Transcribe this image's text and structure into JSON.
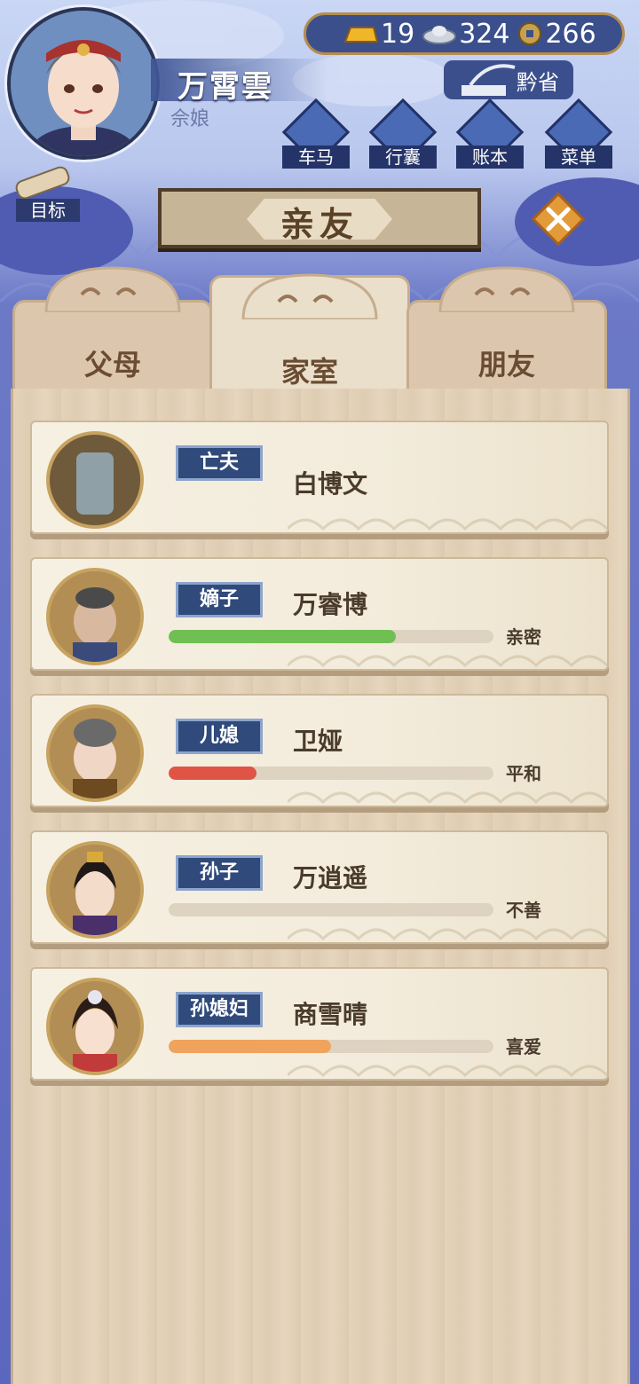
{
  "player": {
    "name": "万霄雲",
    "title": "佘娘"
  },
  "currency": {
    "gold": "19",
    "silver": "324",
    "coin": "266"
  },
  "region": "黔省",
  "menu": [
    {
      "label": "车马",
      "icon": "carriage-icon"
    },
    {
      "label": "行囊",
      "icon": "bag-icon"
    },
    {
      "label": "账本",
      "icon": "ledger-icon"
    },
    {
      "label": "菜单",
      "icon": "more-icon"
    }
  ],
  "goal_label": "目标",
  "page_title": "亲友",
  "tabs": [
    {
      "label": "父母",
      "active": false
    },
    {
      "label": "家室",
      "active": true
    },
    {
      "label": "朋友",
      "active": false
    }
  ],
  "kin": [
    {
      "relation": "亡夫",
      "name": "白博文",
      "mood": null,
      "affinity": null,
      "bar_color": null,
      "portrait": "tombstone"
    },
    {
      "relation": "嫡子",
      "name": "万睿博",
      "mood": "亲密",
      "affinity": 0.7,
      "bar_color": "#6fbf52",
      "portrait": "elder-man"
    },
    {
      "relation": "儿媳",
      "name": "卫娅",
      "mood": "平和",
      "affinity": 0.27,
      "bar_color": "#e05446",
      "portrait": "elder-woman"
    },
    {
      "relation": "孙子",
      "name": "万逍遥",
      "mood": "不善",
      "affinity": 0.0,
      "bar_color": "#e05446",
      "portrait": "young-man"
    },
    {
      "relation": "孙媳妇",
      "name": "商雪晴",
      "mood": "喜爱",
      "affinity": 0.5,
      "bar_color": "#f0a35c",
      "portrait": "young-woman"
    }
  ],
  "colors": {
    "accent_blue": "#2f4a7b",
    "wood": "#e3d2b9",
    "brown_text": "#5a4127"
  }
}
